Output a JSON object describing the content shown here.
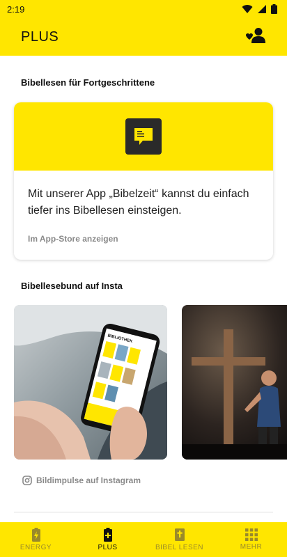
{
  "status": {
    "time": "2:19"
  },
  "appbar": {
    "title": "PLUS",
    "action_icon": "favorite-person-icon"
  },
  "section1": {
    "title": "Bibellesen für Fortgeschrittene"
  },
  "card": {
    "text": "Mit unserer App „Bibelzeit“ kannst du einfach tiefer ins Bibellesen einsteigen.",
    "link": "Im App-Store anzeigen"
  },
  "section2": {
    "title": "Bibellesebund auf Insta"
  },
  "insta": {
    "link": "Bildimpulse auf Instagram"
  },
  "phone_screen": {
    "header": "BIBLIOTHEK"
  },
  "nav": [
    {
      "label": "ENERGY",
      "icon": "battery-bolt-icon",
      "active": false
    },
    {
      "label": "PLUS",
      "icon": "battery-plus-icon",
      "active": true
    },
    {
      "label": "BIBEL LESEN",
      "icon": "bible-icon",
      "active": false
    },
    {
      "label": "MEHR",
      "icon": "grid-icon",
      "active": false
    }
  ],
  "colors": {
    "brand_yellow": "#ffe600",
    "muted_text": "#8a8a8a"
  }
}
